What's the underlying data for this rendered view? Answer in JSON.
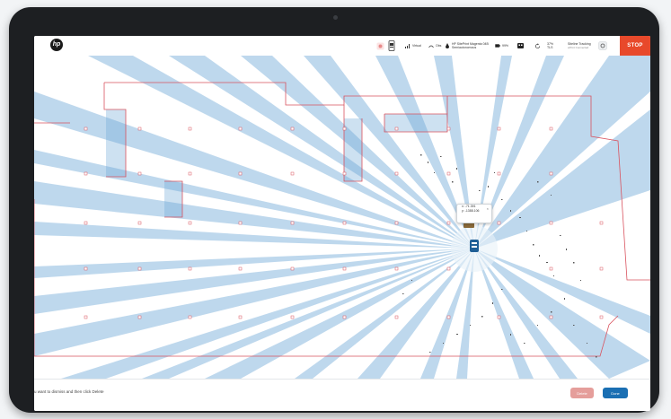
{
  "topbar": {
    "logo": "hp",
    "wifi_label": "Virtual",
    "obstacle_label": "Obs",
    "device_name": "HP SitePrint Magenta 04B",
    "device_status": "Semiautonomous",
    "battery_label": "99%",
    "speed_value": "37%",
    "speed_unit": "TLS",
    "tracking_title": "Siteline Tracking",
    "tracking_status": "ePrint Connected",
    "stop_label": "STOP"
  },
  "tooltip": {
    "x_value": "x: -71.391",
    "y_value": "y: -1388.106"
  },
  "bottombar": {
    "hint": "u want to dismiss and then click Delete",
    "delete_label": "Delete",
    "done_label": "Done"
  },
  "colors": {
    "beam": "#6fa8d6",
    "wall": "#d9535f",
    "stop": "#e8492b",
    "done": "#1a6fb3",
    "delete": "#e59e9b"
  },
  "icons": [
    "hp-logo",
    "record-icon",
    "printer-icon",
    "wifi-icon",
    "obstacle-icon",
    "drop-icon",
    "battery-icon",
    "robot-status-icon",
    "refresh-icon",
    "settings-icon",
    "robot-icon"
  ]
}
